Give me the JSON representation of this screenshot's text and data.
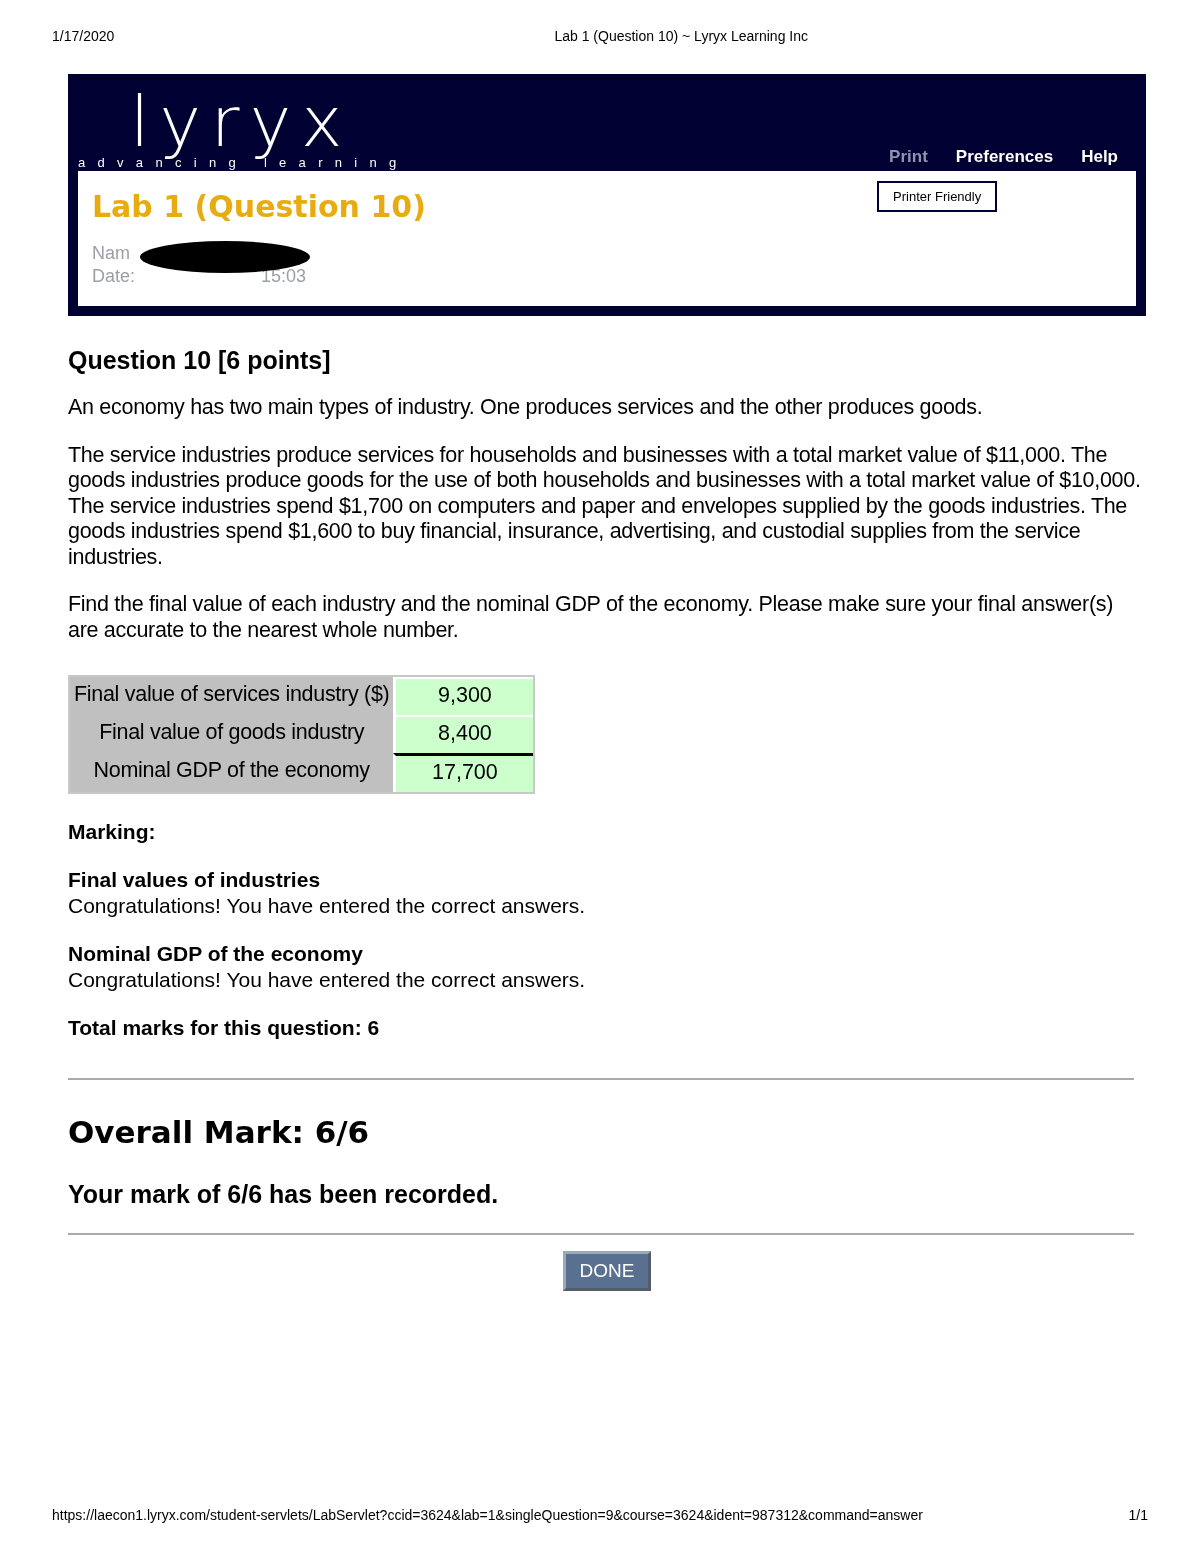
{
  "print_header": {
    "date": "1/17/2020",
    "title": "Lab 1 (Question 10) ~ Lyryx Learning Inc"
  },
  "banner": {
    "logo": "lyryx",
    "tagline": "advancing learning",
    "nav": [
      {
        "label": "Print",
        "disabled": true
      },
      {
        "label": "Preferences",
        "disabled": false
      },
      {
        "label": "Help",
        "disabled": false
      }
    ],
    "dropdown_item": "Printer Friendly",
    "page_title": "Lab 1 (Question 10)",
    "name_label": "Nam",
    "date_label": "Date:",
    "time": "15:03",
    "redacted": true
  },
  "question": {
    "heading": "Question 10 [6 points]",
    "paragraphs": [
      "An economy has two main types of industry. One produces services and the other produces goods.",
      "The service industries produce services for households and businesses with a total market value of $11,000. The goods industries produce goods for the use of both households and businesses with a total market value of $10,000. The service industries spend $1,700 on computers and paper and envelopes supplied by the goods industries. The goods industries spend $1,600 to buy financial, insurance, advertising, and custodial supplies from the service industries.",
      "Find the final value of each industry and the nominal GDP of the economy. Please make sure your final answer(s) are accurate to the nearest whole number."
    ]
  },
  "answers": [
    {
      "label": "Final value of services industry ($)",
      "value": "9,300",
      "correct": true
    },
    {
      "label": "Final value of goods industry",
      "value": "8,400",
      "correct": true
    },
    {
      "label": "Nominal GDP of the economy",
      "value": "17,700",
      "correct": true
    }
  ],
  "marking": {
    "heading": "Marking:",
    "sections": [
      {
        "title": "Final values of industries",
        "text": "Congratulations! You have entered the correct answers."
      },
      {
        "title": "Nominal GDP of the economy",
        "text": "Congratulations! You have entered the correct answers."
      }
    ],
    "total": "Total marks for this question: 6"
  },
  "overall": {
    "heading": "Overall Mark: 6/6",
    "recorded": "Your mark of 6/6 has been recorded.",
    "button": "DONE"
  },
  "print_footer": {
    "url": "https://laecon1.lyryx.com/student-servlets/LabServlet?ccid=3624&lab=1&singleQuestion=9&course=3624&ident=987312&command=answer",
    "page": "1/1"
  }
}
